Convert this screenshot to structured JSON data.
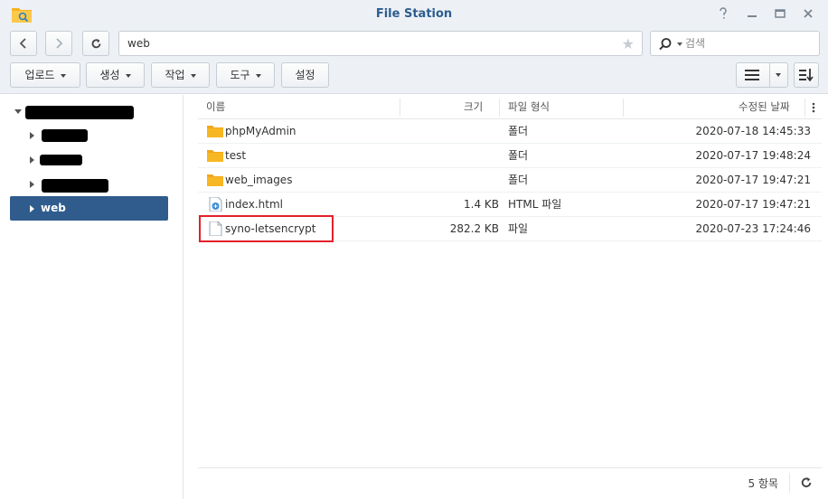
{
  "window": {
    "title": "File Station",
    "controls": [
      "help",
      "minimize",
      "maximize",
      "close"
    ]
  },
  "nav": {
    "path": "web",
    "search_placeholder": "검색"
  },
  "toolbar": {
    "buttons": [
      "업로드",
      "생성",
      "작업",
      "도구",
      "설정"
    ]
  },
  "tree": {
    "selected_label": "web"
  },
  "grid": {
    "columns": [
      "이름",
      "크기",
      "파일 형식",
      "수정된 날짜"
    ],
    "rows": [
      {
        "name": "phpMyAdmin",
        "size": "",
        "type": "폴더",
        "modified": "2020-07-18 14:45:33",
        "icon": "folder-icon"
      },
      {
        "name": "test",
        "size": "",
        "type": "폴더",
        "modified": "2020-07-17 19:48:24",
        "icon": "folder-icon"
      },
      {
        "name": "web_images",
        "size": "",
        "type": "폴더",
        "modified": "2020-07-17 19:47:21",
        "icon": "folder-icon"
      },
      {
        "name": "index.html",
        "size": "1.4 KB",
        "type": "HTML 파일",
        "modified": "2020-07-17 19:47:21",
        "icon": "html-file-icon"
      },
      {
        "name": "syno-letsencrypt",
        "size": "282.2 KB",
        "type": "파일",
        "modified": "2020-07-23 17:24:46",
        "icon": "generic-file-icon"
      }
    ]
  },
  "status": {
    "item_count": "5 항목"
  },
  "colors": {
    "chrome": "#edf1f5",
    "title": "#2d5d8f",
    "selected": "#2f5c8c",
    "folder": "#f7b722",
    "highlight": "#e2212a"
  }
}
